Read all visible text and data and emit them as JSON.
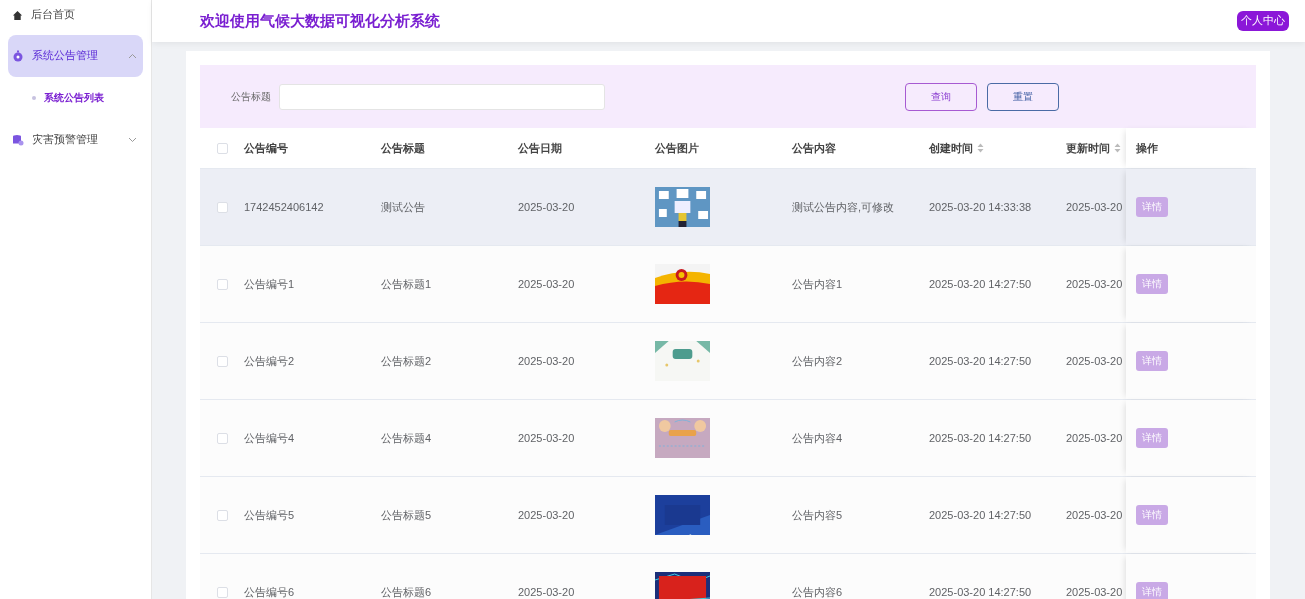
{
  "sidebar": {
    "items": [
      {
        "label": "后台首页",
        "selected": false
      },
      {
        "label": "系统公告管理",
        "selected": true,
        "expanded": true,
        "children": [
          {
            "label": "系统公告列表",
            "selected": true
          }
        ]
      },
      {
        "label": "灾害预警管理",
        "selected": false,
        "expanded": false
      }
    ]
  },
  "header": {
    "title": "欢迎使用气候大数据可视化分析系统",
    "user_button": "个人中心"
  },
  "search": {
    "label": "公告标题",
    "buttons": [
      {
        "label": "查询",
        "kind": "primary"
      },
      {
        "label": "重置",
        "kind": "secondary"
      }
    ]
  },
  "table": {
    "header_checkbox": {
      "checked": false
    },
    "columns": [
      {
        "label": "公告编号",
        "sortable": false
      },
      {
        "label": "公告标题",
        "sortable": false
      },
      {
        "label": "公告日期",
        "sortable": false
      },
      {
        "label": "公告图片",
        "sortable": false
      },
      {
        "label": "公告内容",
        "sortable": false
      },
      {
        "label": "创建时间",
        "sortable": true
      },
      {
        "label": "更新时间",
        "sortable": true
      },
      {
        "label": "操作",
        "sortable": false
      }
    ],
    "rows": [
      {
        "checked": false,
        "highlighted": true,
        "cells": [
          "1742452406142",
          "测试公告",
          "2025-03-20",
          {
            "kind": "picture"
          },
          "测试公告内容,可修改",
          "2025-03-20 14:33:38",
          "2025-03-20",
          "详情"
        ]
      },
      {
        "checked": false,
        "highlighted": false,
        "cells": [
          "公告编号1",
          "公告标题1",
          "2025-03-20",
          {
            "kind": "picture"
          },
          "公告内容1",
          "2025-03-20 14:27:50",
          "2025-03-20",
          "详情"
        ]
      },
      {
        "checked": false,
        "highlighted": false,
        "cells": [
          "公告编号2",
          "公告标题2",
          "2025-03-20",
          {
            "kind": "picture"
          },
          "公告内容2",
          "2025-03-20 14:27:50",
          "2025-03-20",
          "详情"
        ]
      },
      {
        "checked": false,
        "highlighted": false,
        "cells": [
          "公告编号4",
          "公告标题4",
          "2025-03-20",
          {
            "kind": "picture"
          },
          "公告内容4",
          "2025-03-20 14:27:50",
          "2025-03-20",
          "详情"
        ]
      },
      {
        "checked": false,
        "highlighted": false,
        "cells": [
          "公告编号5",
          "公告标题5",
          "2025-03-20",
          {
            "kind": "picture"
          },
          "公告内容5",
          "2025-03-20 14:27:50",
          "2025-03-20",
          "详情"
        ]
      },
      {
        "checked": false,
        "highlighted": false,
        "cells": [
          "公告编号6",
          "公告标题6",
          "2025-03-20",
          {
            "kind": "picture"
          },
          "公告内容6",
          "2025-03-20 14:27:50",
          "2025-03-20",
          "详情"
        ]
      }
    ]
  }
}
